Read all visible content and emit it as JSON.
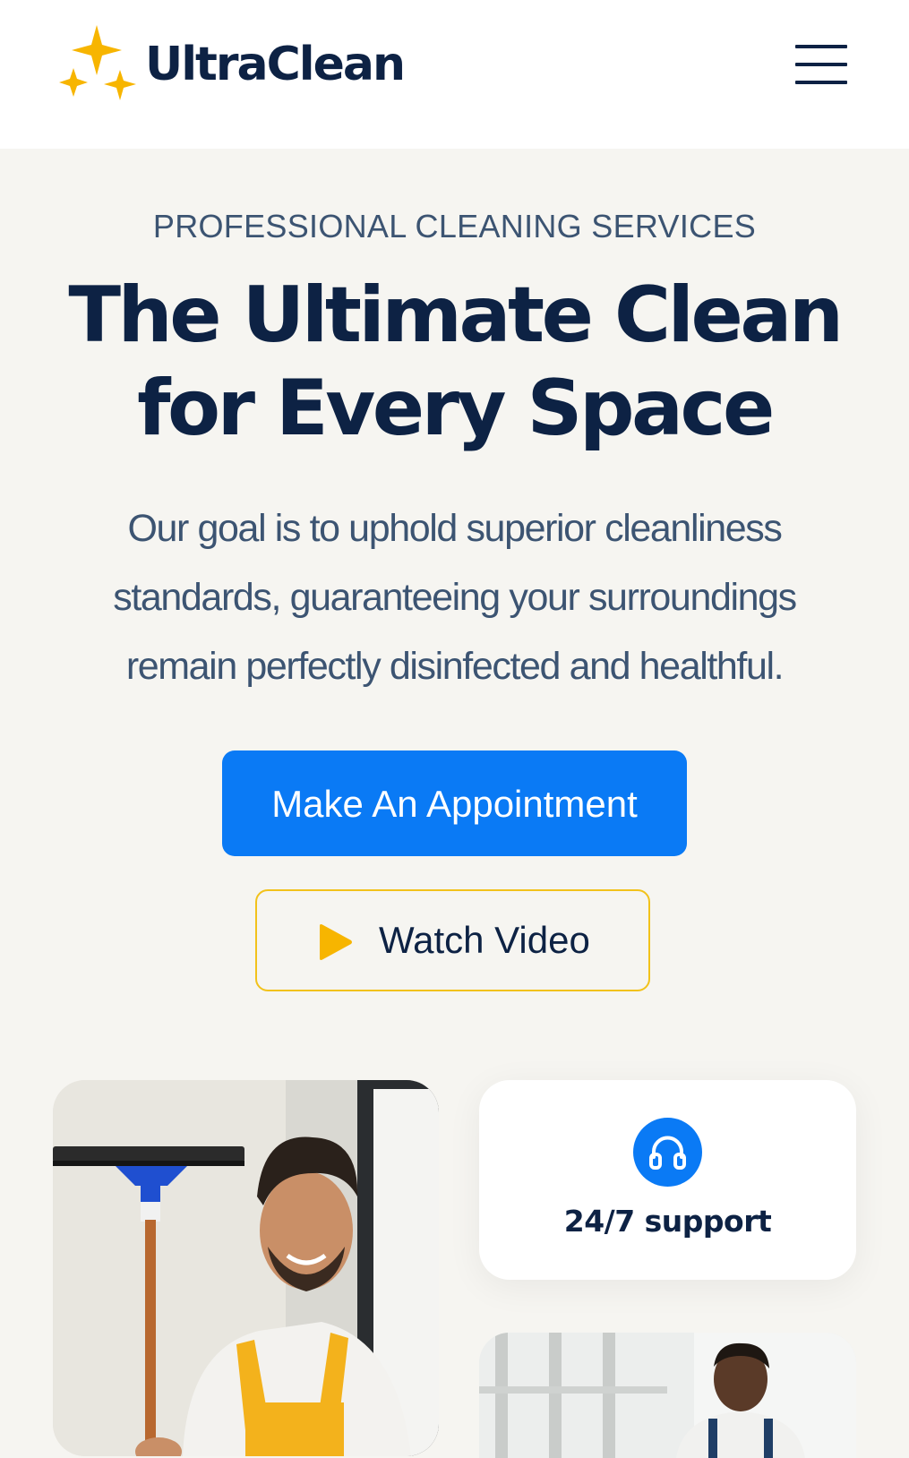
{
  "header": {
    "brand_name": "UltraClean",
    "logo_icon": "sparkles-icon",
    "menu_icon": "hamburger-menu-icon"
  },
  "hero": {
    "eyebrow": "PROFESSIONAL CLEANING SERVICES",
    "headline_lines": [
      "The Ultimate Clean",
      "for Every Space"
    ],
    "description_lines": [
      "Our goal is to uphold superior cleanliness",
      "standards, guaranteeing your surroundings",
      "remain perfectly disinfected and healthful."
    ],
    "primary_button_label": "Make An Appointment",
    "secondary_button_label": "Watch Video",
    "secondary_button_icon": "play-icon"
  },
  "features": {
    "support_label": "24/7 support",
    "support_icon": "headphones-icon",
    "photo_1": "cleaner-with-squeegee-photo",
    "photo_2": "cleaner-at-work-photo"
  },
  "colors": {
    "primary": "#0a7af5",
    "accent": "#f7b500",
    "navy": "#0d2244",
    "background": "#f6f5f1"
  }
}
